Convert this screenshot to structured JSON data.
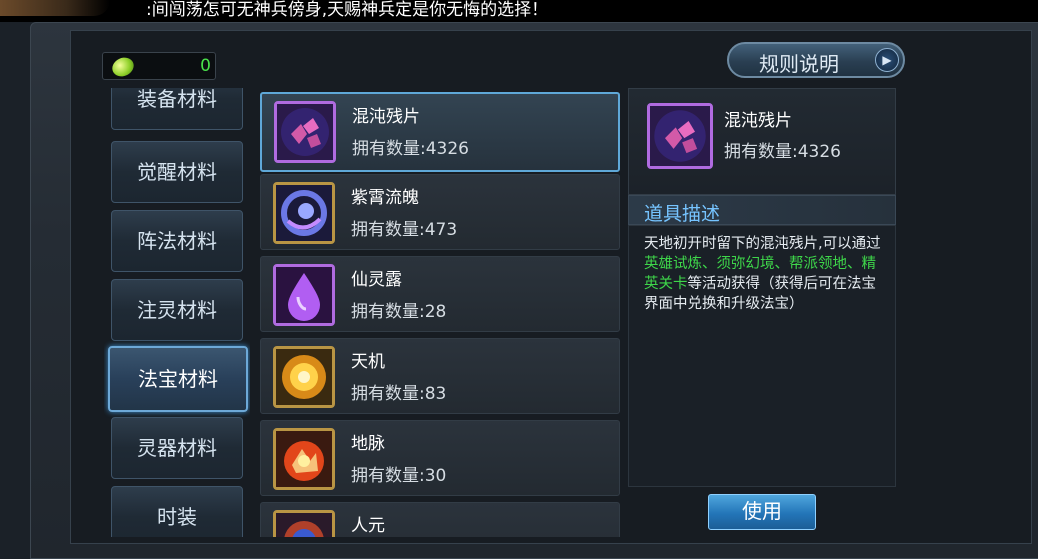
{
  "ticker": {
    "text": ":间闯荡怎可无神兵傍身,天赐神兵定是你无悔的选择！"
  },
  "currency": {
    "value": "0",
    "icon": "jade-gem-icon"
  },
  "rules_button": {
    "label": "规则说明"
  },
  "categories": [
    {
      "label": "装备材料"
    },
    {
      "label": "觉醒材料"
    },
    {
      "label": "阵法材料"
    },
    {
      "label": "注灵材料"
    },
    {
      "label": "法宝材料"
    },
    {
      "label": "灵器材料"
    },
    {
      "label": "时装"
    }
  ],
  "active_category": "法宝材料",
  "items": [
    {
      "name": "混沌残片",
      "qty": "拥有数量:4326",
      "icon": "chaos-fragment-icon",
      "frame_color": "#b06be0"
    },
    {
      "name": "紫霄流魄",
      "qty": "拥有数量:473",
      "icon": "purple-orb-icon",
      "frame_color": "#b99544"
    },
    {
      "name": "仙灵露",
      "qty": "拥有数量:28",
      "icon": "purple-droplet-icon",
      "frame_color": "#b06be0"
    },
    {
      "name": "天机",
      "qty": "拥有数量:83",
      "icon": "golden-sun-icon",
      "frame_color": "#b99544"
    },
    {
      "name": "地脉",
      "qty": "拥有数量:30",
      "icon": "fire-rock-icon",
      "frame_color": "#b99544"
    },
    {
      "name": "人元",
      "qty": "",
      "icon": "red-orb-icon",
      "frame_color": "#b99544"
    }
  ],
  "detail": {
    "name": "混沌残片",
    "qty": "拥有数量:4326",
    "desc_title": "道具描述",
    "desc_part1": "天地初开时留下的混沌残片,可以通过",
    "desc_highlight": "英雄试炼、须弥幻境、帮派领地、精英关卡",
    "desc_part2": "等活动获得（获得后可在法宝界面中兑换和升级法宝）",
    "use_label": "使用"
  }
}
